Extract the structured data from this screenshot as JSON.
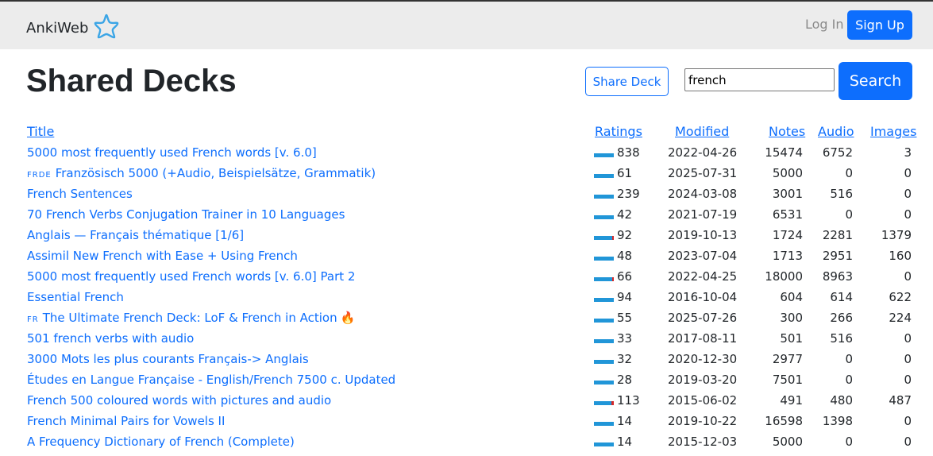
{
  "nav": {
    "brand": "AnkiWeb",
    "brand_icon": "star-icon",
    "login": "Log In",
    "signup": "Sign Up"
  },
  "header": {
    "title": "Shared Decks",
    "share_button": "Share Deck",
    "search_value": "french",
    "search_button": "Search"
  },
  "table": {
    "columns": {
      "title": "Title",
      "ratings": "Ratings",
      "modified": "Modified",
      "notes": "Notes",
      "audio": "Audio",
      "images": "Images"
    },
    "rows": [
      {
        "flag": "",
        "title": "5000 most frequently used French words [v. 6.0]",
        "rating": "838",
        "modified": "2022-04-26",
        "notes": "15474",
        "audio": "6752",
        "images": "3",
        "neg": 0.0
      },
      {
        "flag": "FRDE",
        "title": "Französisch 5000 (+Audio, Beispielsätze, Grammatik)",
        "rating": "61",
        "modified": "2025-07-31",
        "notes": "5000",
        "audio": "0",
        "images": "0",
        "neg": 0.0
      },
      {
        "flag": "",
        "title": "French Sentences",
        "rating": "239",
        "modified": "2024-03-08",
        "notes": "3001",
        "audio": "516",
        "images": "0",
        "neg": 0.0
      },
      {
        "flag": "",
        "title": "70 French Verbs Conjugation Trainer in 10 Languages",
        "rating": "42",
        "modified": "2021-07-19",
        "notes": "6531",
        "audio": "0",
        "images": "0",
        "neg": 0.0
      },
      {
        "flag": "",
        "title": "Anglais — Français thématique [1/6]",
        "rating": "92",
        "modified": "2019-10-13",
        "notes": "1724",
        "audio": "2281",
        "images": "1379",
        "neg": 0.05
      },
      {
        "flag": "",
        "title": "Assimil New French with Ease + Using French",
        "rating": "48",
        "modified": "2023-07-04",
        "notes": "1713",
        "audio": "2951",
        "images": "160",
        "neg": 0.0
      },
      {
        "flag": "",
        "title": "5000 most frequently used French words [v. 6.0] Part 2",
        "rating": "66",
        "modified": "2022-04-25",
        "notes": "18000",
        "audio": "8963",
        "images": "0",
        "neg": 0.05
      },
      {
        "flag": "",
        "title": "Essential French",
        "rating": "94",
        "modified": "2016-10-04",
        "notes": "604",
        "audio": "614",
        "images": "622",
        "neg": 0.0
      },
      {
        "flag": "FR",
        "title": "The Ultimate French Deck: LoF & French in Action",
        "fire": true,
        "rating": "55",
        "modified": "2025-07-26",
        "notes": "300",
        "audio": "266",
        "images": "224",
        "neg": 0.0
      },
      {
        "flag": "",
        "title": "501 french verbs with audio",
        "rating": "33",
        "modified": "2017-08-11",
        "notes": "501",
        "audio": "516",
        "images": "0",
        "neg": 0.0
      },
      {
        "flag": "",
        "title": "3000 Mots les plus courants Français-> Anglais",
        "rating": "32",
        "modified": "2020-12-30",
        "notes": "2977",
        "audio": "0",
        "images": "0",
        "neg": 0.0
      },
      {
        "flag": "",
        "title": "Études en Langue Française - English/French 7500 c. Updated",
        "rating": "28",
        "modified": "2019-03-20",
        "notes": "7501",
        "audio": "0",
        "images": "0",
        "neg": 0.0
      },
      {
        "flag": "",
        "title": "French 500 coloured words with pictures and audio",
        "rating": "113",
        "modified": "2015-06-02",
        "notes": "491",
        "audio": "480",
        "images": "487",
        "neg": 0.12
      },
      {
        "flag": "",
        "title": "French Minimal Pairs for Vowels II",
        "rating": "14",
        "modified": "2019-10-22",
        "notes": "16598",
        "audio": "1398",
        "images": "0",
        "neg": 0.0
      },
      {
        "flag": "",
        "title": "A Frequency Dictionary of French (Complete)",
        "rating": "14",
        "modified": "2015-12-03",
        "notes": "5000",
        "audio": "0",
        "images": "0",
        "neg": 0.0
      }
    ]
  }
}
